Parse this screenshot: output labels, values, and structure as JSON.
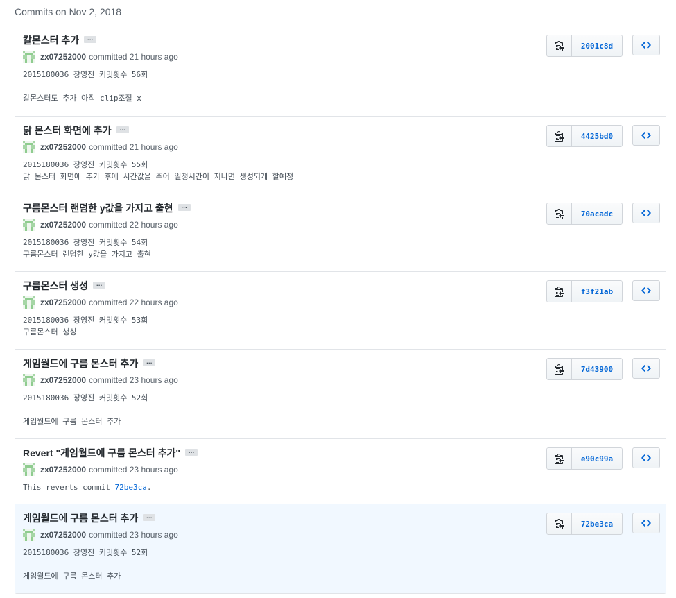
{
  "group": {
    "title": "Commits on Nov 2, 2018"
  },
  "expander_label": "…",
  "commits": [
    {
      "message": "칼몬스터 추가",
      "author": "zx07252000",
      "committed": "committed 21 hours ago",
      "body": [
        "2015180036 장영진 커밋횟수 56회",
        "",
        "칼몬스터도 추가 아직 clip조절 x"
      ],
      "sha": "2001c8d"
    },
    {
      "message": "닭 몬스터 화면에 추가",
      "author": "zx07252000",
      "committed": "committed 21 hours ago",
      "body": [
        "2015180036 장영진 커밋횟수 55회",
        "닭 몬스터 화면에 추가 후에 시간값을 주어 일정시간이 지나면 생성되게 할예정"
      ],
      "sha": "4425bd0"
    },
    {
      "message": "구름몬스터 랜덤한 y값을 가지고 출현",
      "author": "zx07252000",
      "committed": "committed 22 hours ago",
      "body": [
        "2015180036 장영진 커밋횟수 54회",
        "구름몬스터 랜덤한 y값을 가지고 출현"
      ],
      "sha": "70acadc"
    },
    {
      "message": "구름몬스터 생성",
      "author": "zx07252000",
      "committed": "committed 22 hours ago",
      "body": [
        "2015180036 장영진 커밋횟수 53회",
        "구름몬스터 생성"
      ],
      "sha": "f3f21ab"
    },
    {
      "message": "게임월드에 구름 몬스터 추가",
      "author": "zx07252000",
      "committed": "committed 23 hours ago",
      "body": [
        "2015180036 장영진 커밋횟수 52회",
        "",
        "게임월드에 구름 몬스터 추가"
      ],
      "sha": "7d43900"
    },
    {
      "message": "Revert \"게임월드에 구름 몬스터 추가\"",
      "author": "zx07252000",
      "committed": "committed 23 hours ago",
      "body_prefix": "This reverts commit ",
      "body_ref": "72be3ca",
      "body_suffix": ".",
      "sha": "e90c99a"
    },
    {
      "message": "게임월드에 구름 몬스터 추가",
      "author": "zx07252000",
      "committed": "committed 23 hours ago",
      "body": [
        "2015180036 장영진 커밋횟수 52회",
        "",
        "게임월드에 구름 몬스터 추가"
      ],
      "sha": "72be3ca",
      "highlighted": true
    }
  ],
  "colors": {
    "link": "#0366d6",
    "highlight": "#f1f8ff",
    "border": "#e1e4e8"
  },
  "icons": {
    "copy": "clipboard-icon",
    "browse": "code-icon"
  }
}
